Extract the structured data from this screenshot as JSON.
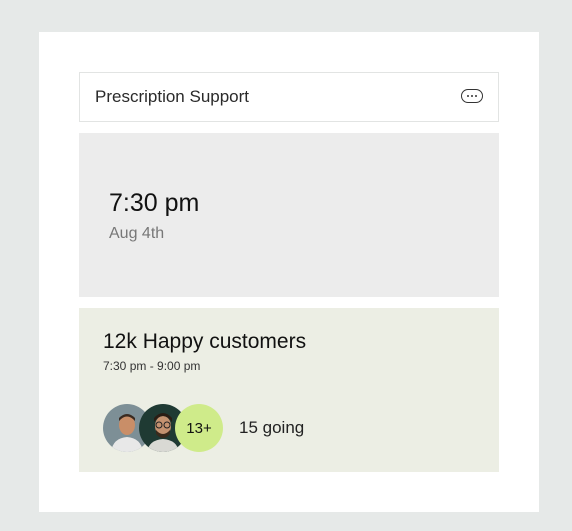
{
  "header": {
    "title": "Prescription Support",
    "more_icon": "more-horizontal-icon"
  },
  "time_panel": {
    "time": "7:30 pm",
    "date": "Aug 4th"
  },
  "event": {
    "title": "12k Happy customers",
    "time_range": "7:30 pm - 9:00 pm",
    "attendee_count_label": "13+",
    "going_label": "15 going"
  },
  "colors": {
    "page_bg": "#e6e9e8",
    "time_panel_bg": "#ececec",
    "event_panel_bg": "#eceee4",
    "count_bubble": "#cfeb8a"
  }
}
